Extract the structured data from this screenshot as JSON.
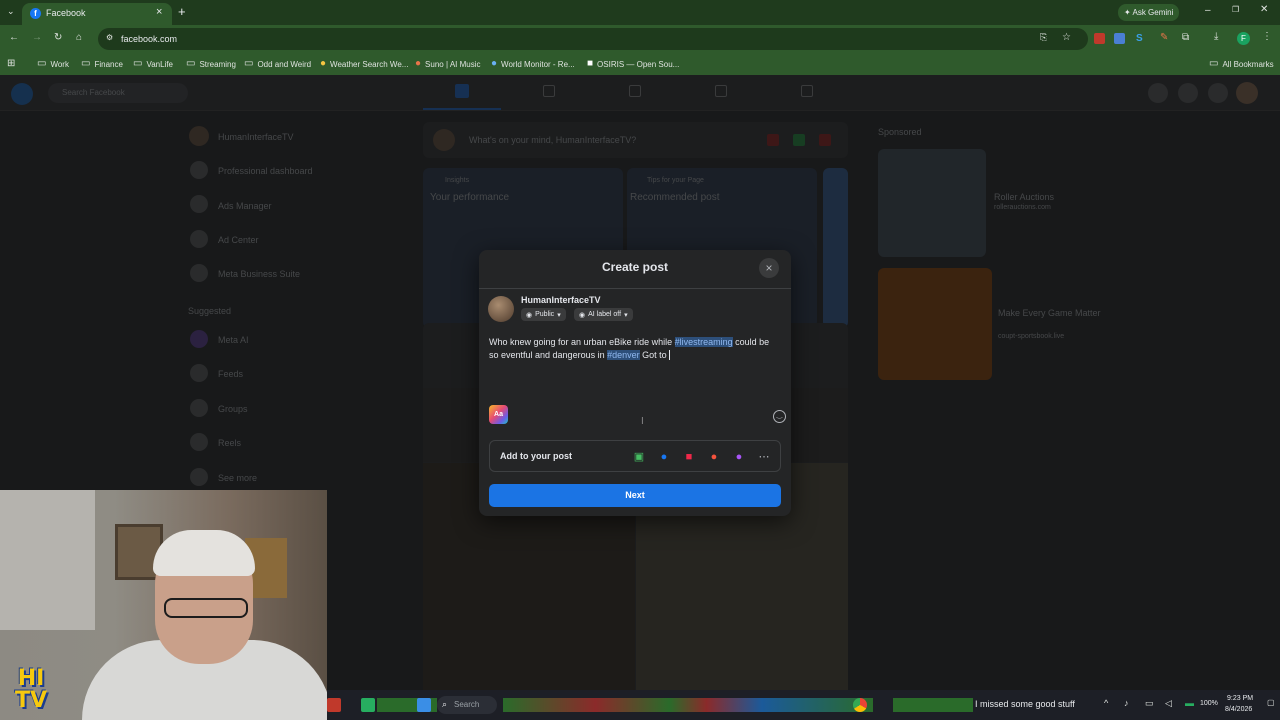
{
  "browser": {
    "tab_title": "Facebook",
    "tab_close": "×",
    "new_tab": "+",
    "ask_gemini": "Ask Gemini",
    "url": "facebook.com",
    "bookmarks": [
      "Work",
      "Finance",
      "VanLife",
      "Streaming",
      "Odd and Weird",
      "Weather Search We...",
      "Suno | AI Music",
      "World Monitor - Re...",
      "OSIRIS — Open Sou..."
    ],
    "all_bookmarks": "All Bookmarks"
  },
  "facebook_bg": {
    "search_placeholder": "Search Facebook",
    "composer_placeholder": "What's on your mind, HumanInterfaceTV?",
    "sidebar": [
      "HumanInterfaceTV",
      "Professional dashboard",
      "Ads Manager",
      "Ad Center",
      "Meta Business Suite"
    ],
    "suggested_label": "Suggested",
    "suggested": [
      "Meta AI",
      "Feeds",
      "Groups",
      "Reels"
    ],
    "see_more": "See more",
    "sponsored_label": "Sponsored",
    "ads": [
      {
        "title": "Roller Auctions",
        "url": "rollerauctions.com"
      },
      {
        "title": "Make Every Game Matter",
        "url": "coupt-sportsbook.live"
      }
    ],
    "insights_label": "Insights",
    "performance_title": "Your performance",
    "tips_label": "Tips for your Page",
    "recommended_title": "Recommended post"
  },
  "modal": {
    "title": "Create post",
    "close": "×",
    "username": "HumanInterfaceTV",
    "privacy": "Public",
    "ai_label": "AI label off",
    "post_text_before": "Who knew going for an urban eBike ride while ",
    "hashtag1": "#livestreaming",
    "post_text_middle": " could be so eventful and dangerous in ",
    "hashtag2": "#denver",
    "post_text_after": " Got to",
    "aa_label": "Aa",
    "add_to_post": "Add to your post",
    "add_icons": [
      "photo-video-icon",
      "tag-people-icon",
      "live-video-icon",
      "check-in-icon",
      "gif-icon",
      "more-icon"
    ],
    "next": "Next"
  },
  "taskbar": {
    "search": "Search",
    "ticker": "I missed some good stuff",
    "time": "9:23 PM",
    "date": "8/4/2026",
    "battery": "100%"
  },
  "webcam_logo": "HI TV",
  "colors": {
    "chrome_green": "#2f5a2c",
    "modal_bg": "#242526",
    "next_blue": "#1b74e4",
    "hashtag_bg": "#2d4f7a"
  }
}
